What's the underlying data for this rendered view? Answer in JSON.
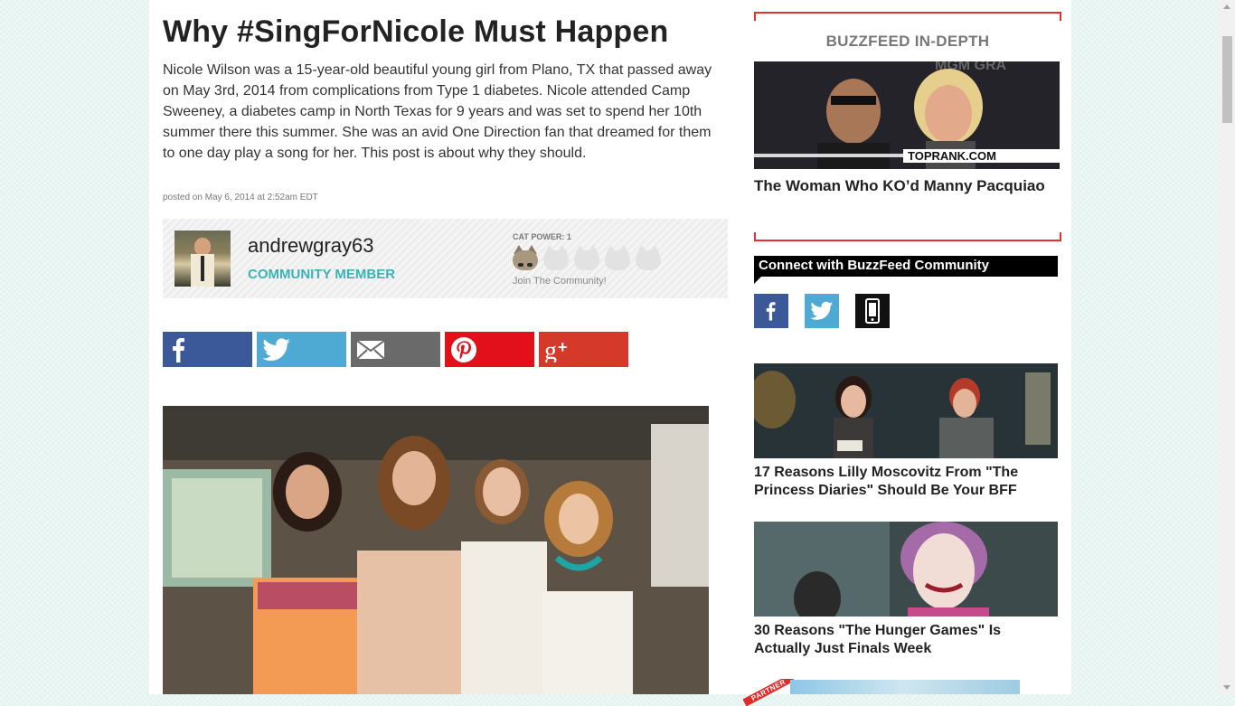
{
  "article": {
    "title": "Why #SingForNicole Must Happen",
    "description": "Nicole Wilson was a 15-year-old beautiful young girl from Plano, TX that passed away on May 3rd, 2014 from complications from Type 1 diabetes. Nicole attended Camp Sweeney, a diabetes camp in North Texas for 9 years and was set to spend her 10th summer there this summer. She was an avid One Direction fan that dreamed for them to one day play a song for her. This post is about why they should.",
    "posted": "posted on May 6, 2014 at 2:52am EDT"
  },
  "author": {
    "name": "andrewgray63",
    "role": "COMMUNITY MEMBER",
    "cat_power_label": "CAT POWER: 1",
    "cat_power_level": 1,
    "cat_power_max": 5,
    "join_text": "Join The Community!"
  },
  "share_buttons": [
    {
      "name": "facebook",
      "icon": "facebook-icon",
      "color": "#3b5998"
    },
    {
      "name": "twitter",
      "icon": "twitter-icon",
      "color": "#4eaad3"
    },
    {
      "name": "email",
      "icon": "email-icon",
      "color": "#6a6a6a"
    },
    {
      "name": "pinterest",
      "icon": "pinterest-icon",
      "color": "#e2101b"
    },
    {
      "name": "google-plus",
      "icon": "google-plus-icon",
      "color": "#d5392a"
    }
  ],
  "sidebar": {
    "indepth_title": "BUZZFEED IN-DEPTH",
    "indepth_caption": "The Woman Who KO’d Manny Pacquiao",
    "indepth_image_text": "TOPRANK.COM",
    "indepth_image_text2": "MGM GRA",
    "connect_title": "Connect with BuzzFeed Community",
    "social": [
      {
        "name": "facebook",
        "icon": "facebook-icon"
      },
      {
        "name": "twitter",
        "icon": "twitter-icon"
      },
      {
        "name": "mobile",
        "icon": "phone-icon"
      }
    ],
    "stories": [
      {
        "caption": "17 Reasons Lilly Moscovitz From \"The Princess Diaries\" Should Be Your BFF"
      },
      {
        "caption": "30 Reasons \"The Hunger Games\" Is Actually Just Finals Week"
      }
    ],
    "partner_label": "PARTNER"
  },
  "colors": {
    "accent_teal": "#3bb2b6",
    "indepth_border": "#dd3333",
    "background": "#e4f2f0"
  }
}
